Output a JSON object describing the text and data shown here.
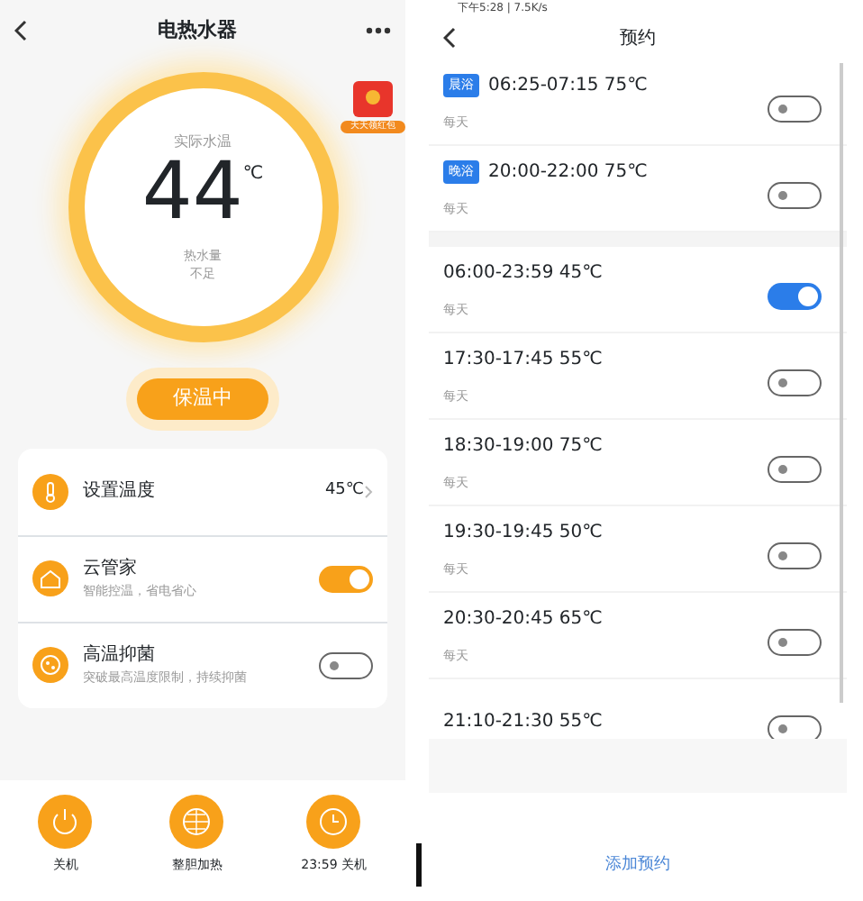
{
  "heater": {
    "title": "电热水器",
    "promo": "天天领红包",
    "temperature": {
      "label": "实际水温",
      "value": "44",
      "unit": "℃",
      "water_label": "热水量",
      "water_value": "不足"
    },
    "mode": "保温中",
    "settings": [
      {
        "kind": "value",
        "title": "设置温度",
        "value": "45℃"
      },
      {
        "kind": "toggle",
        "title": "云管家",
        "subtitle": "智能控温，省电省心",
        "on": true
      },
      {
        "kind": "toggle",
        "title": "高温抑菌",
        "subtitle": "突破最高温度限制，持续抑菌",
        "on": false
      }
    ],
    "actions": [
      {
        "label": "关机"
      },
      {
        "label": "整胆加热"
      },
      {
        "label": "23:59 关机"
      }
    ]
  },
  "schedule": {
    "status": "下午5:28 | 7.5K/s",
    "title": "预约",
    "groups": [
      [
        {
          "tag": "晨浴",
          "time": "06:25-07:15  75℃",
          "repeat": "每天",
          "on": false
        },
        {
          "tag": "晚浴",
          "time": "20:00-22:00  75℃",
          "repeat": "每天",
          "on": false
        }
      ],
      [
        {
          "time": "06:00-23:59  45℃",
          "repeat": "每天",
          "on": true
        },
        {
          "time": "17:30-17:45  55℃",
          "repeat": "每天",
          "on": false
        },
        {
          "time": "18:30-19:00  75℃",
          "repeat": "每天",
          "on": false
        },
        {
          "time": "19:30-19:45  50℃",
          "repeat": "每天",
          "on": false
        },
        {
          "time": "20:30-20:45  65℃",
          "repeat": "每天",
          "on": false
        },
        {
          "time": "21:10-21:30  55℃",
          "on": false
        }
      ]
    ],
    "add": "添加预约"
  }
}
